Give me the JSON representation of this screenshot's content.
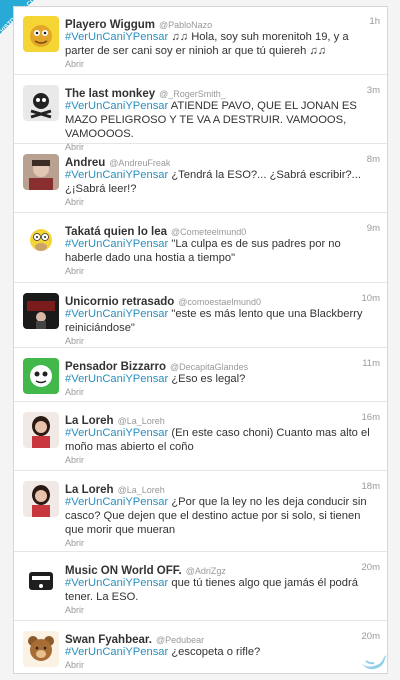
{
  "watermark": "VISTOENTS.COM",
  "colors": {
    "hashtag": "#2a8fc0",
    "name": "#333333",
    "meta": "#999999"
  },
  "tweets": [
    {
      "name": "Playero Wiggum",
      "handle": "@PabloNazo",
      "time": "1h",
      "hashtag": "#VerUnCaniYPensar",
      "text": " ♫♫ Hola, soy suh morenitoh 19, y a parter de ser cani soy er ninioh ar que tú quiereh ♫♫",
      "action": "Abrir",
      "avatar_icon": "yellow-cartoon-avatar-icon"
    },
    {
      "name": "The last monkey",
      "handle": "@_RogerSmith_",
      "time": "3m",
      "hashtag": "#VerUnCaniYPensar",
      "text": " ATIENDE PAVO, QUE EL JONAN ES MAZO PELIGROSO Y TE VA A DESTRUIR. VAMOOOS, VAMOOOOS.",
      "action": "Abrir",
      "avatar_icon": "pirate-skull-avatar-icon"
    },
    {
      "name": "Andreu",
      "handle": "@AndreuFreak",
      "time": "8m",
      "hashtag": "#VerUnCaniYPensar",
      "text": " ¿Tendrá la ESO?... ¿Sabrá escribir?... ¿¡Sabrá leer!?",
      "action": "Abrir",
      "avatar_icon": "photo-avatar-icon"
    },
    {
      "name": "Takatá quien lo lea",
      "handle": "@Cometeelmund0",
      "time": "9m",
      "hashtag": "#VerUnCaniYPensar",
      "text": " \"La culpa es de sus padres por no haberle dado una hostia a tiempo\"",
      "action": "Abrir",
      "avatar_icon": "homer-avatar-icon"
    },
    {
      "name": "Unicornio retrasado",
      "handle": "@comoestaelmund0",
      "time": "10m",
      "hashtag": "#VerUnCaniYPensar",
      "text": " \"este es más lento que una Blackberry reiniciándose\"",
      "action": "Abrir",
      "avatar_icon": "concert-avatar-icon"
    },
    {
      "name": "Pensador Bizzarro",
      "handle": "@DecapitaGlandes",
      "time": "11m",
      "hashtag": "#VerUnCaniYPensar",
      "text": " ¿Eso es legal?",
      "action": "Abrir",
      "avatar_icon": "green-cartoon-avatar-icon"
    },
    {
      "name": "La Loreh",
      "handle": "@La_Loreh",
      "time": "16m",
      "hashtag": "#VerUnCaniYPensar",
      "text": " (En este caso choni) Cuanto mas alto el moño mas abierto el coño",
      "action": "Abrir",
      "avatar_icon": "woman-avatar-icon"
    },
    {
      "name": "La Loreh",
      "handle": "@La_Loreh",
      "time": "18m",
      "hashtag": "#VerUnCaniYPensar",
      "text": " ¿Por que la ley no les deja conducir sin casco? Que dejen que el destino actue por si solo, si tienen que morir que mueran",
      "action": "Abrir",
      "avatar_icon": "woman-avatar-icon"
    },
    {
      "name": "Music ON World OFF.",
      "handle": "@AdriZgz",
      "time": "20m",
      "hashtag": "#VerUnCaniYPensar",
      "text": " que tú tienes algo que jamás él podrá tener. La ESO.",
      "action": "Abrir",
      "avatar_icon": "music-avatar-icon"
    },
    {
      "name": "Swan Fyahbear.",
      "handle": "@Pedubear",
      "time": "20m",
      "hashtag": "#VerUnCaniYPensar",
      "text": " ¿escopeta o rifle?",
      "action": "Abrir",
      "avatar_icon": "bear-avatar-icon"
    }
  ]
}
